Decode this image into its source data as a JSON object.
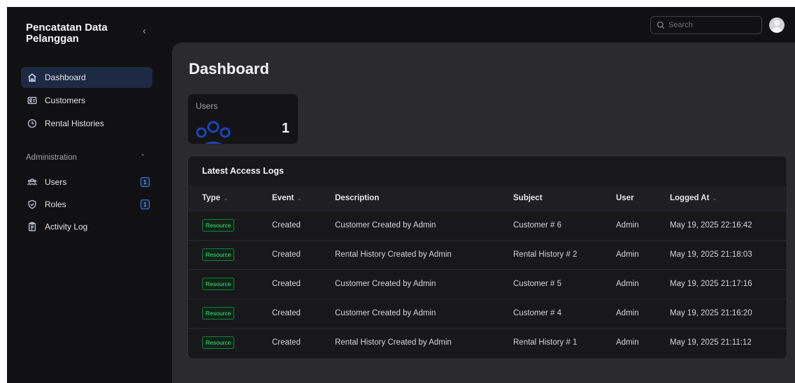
{
  "sidebar": {
    "brand": "Pencatatan Data Pelanggan",
    "collapse_icon": "chevron-left-icon",
    "items": [
      {
        "label": "Dashboard",
        "icon": "home-icon",
        "active": true
      },
      {
        "label": "Customers",
        "icon": "id-card-icon"
      },
      {
        "label": "Rental Histories",
        "icon": "clock-icon"
      }
    ],
    "group": {
      "label": "Administration",
      "items": [
        {
          "label": "Users",
          "icon": "users-icon",
          "badge": "1"
        },
        {
          "label": "Roles",
          "icon": "shield-check-icon",
          "badge": "1"
        },
        {
          "label": "Activity Log",
          "icon": "clipboard-icon"
        }
      ]
    }
  },
  "topbar": {
    "search_placeholder": "Search"
  },
  "main": {
    "title": "Dashboard",
    "stat": {
      "label": "Users",
      "value": "1"
    },
    "logs": {
      "title": "Latest Access Logs",
      "columns": [
        "Type",
        "Event",
        "Description",
        "Subject",
        "User",
        "Logged At"
      ],
      "rows": [
        {
          "type": "Resource",
          "event": "Created",
          "description": "Customer Created by Admin",
          "subject": "Customer # 6",
          "user": "Admin",
          "logged_at": "May 19, 2025 22:16:42"
        },
        {
          "type": "Resource",
          "event": "Created",
          "description": "Rental History Created by Admin",
          "subject": "Rental History # 2",
          "user": "Admin",
          "logged_at": "May 19, 2025 21:18:03"
        },
        {
          "type": "Resource",
          "event": "Created",
          "description": "Customer Created by Admin",
          "subject": "Customer # 5",
          "user": "Admin",
          "logged_at": "May 19, 2025 21:17:16"
        },
        {
          "type": "Resource",
          "event": "Created",
          "description": "Customer Created by Admin",
          "subject": "Customer # 4",
          "user": "Admin",
          "logged_at": "May 19, 2025 21:16:20"
        },
        {
          "type": "Resource",
          "event": "Created",
          "description": "Rental History Created by Admin",
          "subject": "Rental History # 1",
          "user": "Admin",
          "logged_at": "May 19, 2025 21:11:12"
        }
      ]
    }
  },
  "colors": {
    "active_nav": "#1e2a44",
    "badge_green": "#4ade80",
    "accent_blue": "#3b82f6"
  }
}
